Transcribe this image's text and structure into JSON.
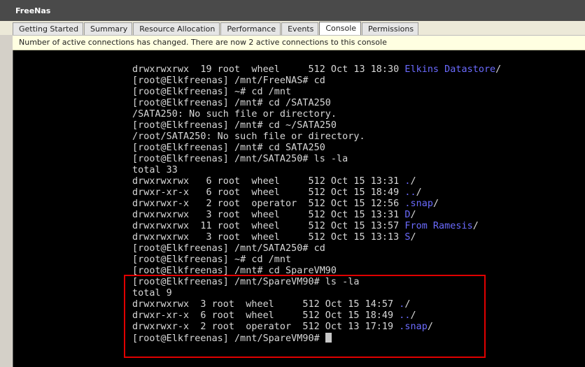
{
  "window": {
    "title": "FreeNas"
  },
  "tabs": [
    {
      "label": "Getting Started",
      "active": false
    },
    {
      "label": "Summary",
      "active": false
    },
    {
      "label": "Resource Allocation",
      "active": false
    },
    {
      "label": "Performance",
      "active": false
    },
    {
      "label": "Events",
      "active": false
    },
    {
      "label": "Console",
      "active": true
    },
    {
      "label": "Permissions",
      "active": false
    }
  ],
  "notice": {
    "text": "Number of active connections has changed. There are now 2 active connections to this console"
  },
  "console": {
    "lines": [
      {
        "text": "drwxrwxrwx  19 root  wheel     512 Oct 13 18:30 ",
        "link": "Elkins Datastore",
        "after": "/"
      },
      {
        "text": "[root@Elkfreenas] /mnt/FreeNAS# cd"
      },
      {
        "text": "[root@Elkfreenas] ~# cd /mnt"
      },
      {
        "text": "[root@Elkfreenas] /mnt# cd /SATA250"
      },
      {
        "text": "/SATA250: No such file or directory."
      },
      {
        "text": "[root@Elkfreenas] /mnt# cd ~/SATA250"
      },
      {
        "text": "/root/SATA250: No such file or directory."
      },
      {
        "text": "[root@Elkfreenas] /mnt# cd SATA250"
      },
      {
        "text": "[root@Elkfreenas] /mnt/SATA250# ls -la"
      },
      {
        "text": "total 33"
      },
      {
        "text": "drwxrwxrwx   6 root  wheel     512 Oct 15 13:31 ",
        "link": ".",
        "after": "/"
      },
      {
        "text": "drwxr-xr-x   6 root  wheel     512 Oct 15 18:49 ",
        "link": "..",
        "after": "/"
      },
      {
        "text": "drwxrwxr-x   2 root  operator  512 Oct 15 12:56 ",
        "link": ".snap",
        "after": "/"
      },
      {
        "text": "drwxrwxrwx   3 root  wheel     512 Oct 15 13:31 ",
        "link": "D",
        "after": "/"
      },
      {
        "text": "drwxrwxrwx  11 root  wheel     512 Oct 15 13:57 ",
        "link": "From Ramesis",
        "after": "/"
      },
      {
        "text": "drwxrwxrwx   3 root  wheel     512 Oct 15 13:13 ",
        "link": "S",
        "after": "/"
      },
      {
        "text": "[root@Elkfreenas] /mnt/SATA250# cd"
      },
      {
        "text": "[root@Elkfreenas] ~# cd /mnt"
      },
      {
        "text": "[root@Elkfreenas] /mnt# cd SpareVM90"
      },
      {
        "text": "[root@Elkfreenas] /mnt/SpareVM90# ls -la"
      },
      {
        "text": "total 9"
      },
      {
        "text": "drwxrwxrwx  3 root  wheel     512 Oct 15 14:57 ",
        "link": ".",
        "after": "/"
      },
      {
        "text": "drwxr-xr-x  6 root  wheel     512 Oct 15 18:49 ",
        "link": "..",
        "after": "/"
      },
      {
        "text": "drwxrwxr-x  2 root  operator  512 Oct 13 17:19 ",
        "link": ".snap",
        "after": "/"
      },
      {
        "text": "[root@Elkfreenas] /mnt/SpareVM90# ",
        "cursor": true
      }
    ]
  },
  "colors": {
    "link": "#6b6bff",
    "highlight_box": "#e00000",
    "console_bg": "#000000"
  }
}
